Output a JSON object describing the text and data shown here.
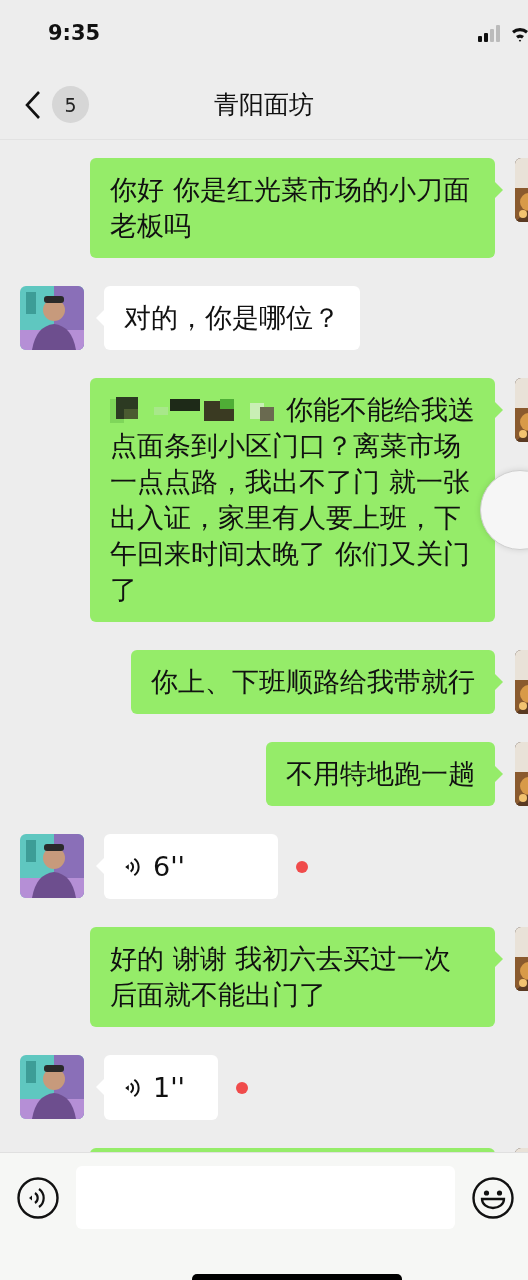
{
  "status_bar": {
    "time": "9:35"
  },
  "header": {
    "unread_count": "5",
    "title": "青阳面坊"
  },
  "messages": [
    {
      "outgoing": true,
      "kind": "text",
      "text": "你好 你是红光菜市场的小刀面老板吗"
    },
    {
      "outgoing": false,
      "kind": "text",
      "text": "对的，你是哪位？"
    },
    {
      "outgoing": true,
      "kind": "text",
      "censored": true,
      "text": "你能不能给我送点面条到小区门口？离菜市场一点点路，我出不了门 就一张出入证，家里有人要上班，下午回来时间太晚了 你们又关门了"
    },
    {
      "outgoing": true,
      "kind": "text",
      "text": "你上、下班顺路给我带就行"
    },
    {
      "outgoing": true,
      "kind": "text",
      "text": "不用特地跑一趟"
    },
    {
      "outgoing": false,
      "kind": "voice",
      "duration": "6''",
      "unread": true
    },
    {
      "outgoing": true,
      "kind": "text",
      "text": "好的 谢谢 我初六去买过一次后面就不能出门了"
    },
    {
      "outgoing": false,
      "kind": "voice",
      "duration": "1''",
      "unread": true
    },
    {
      "outgoing": true,
      "kind": "cut"
    }
  ]
}
